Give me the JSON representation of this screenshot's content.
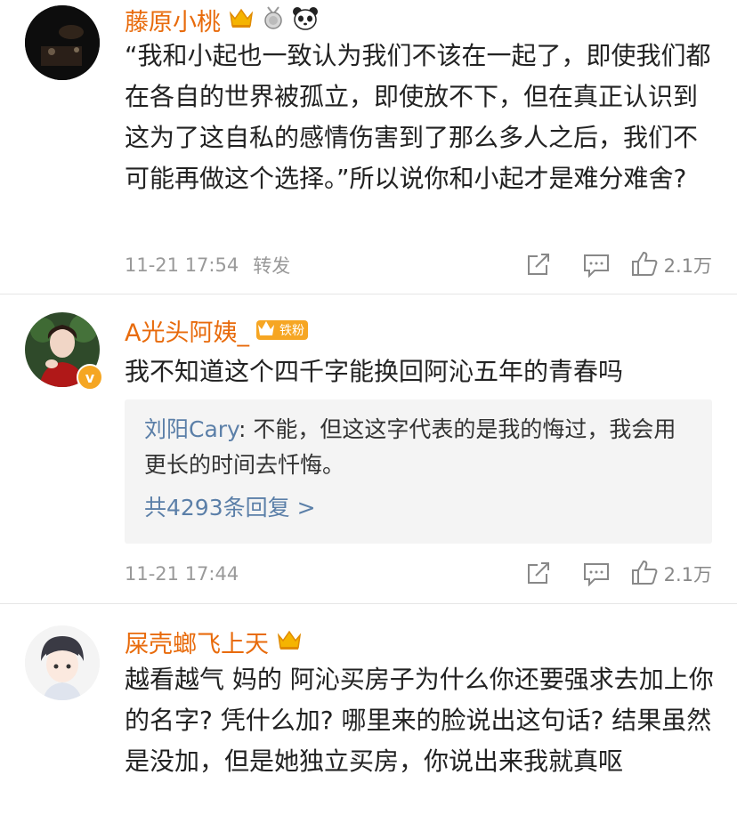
{
  "comments": [
    {
      "username": "藤原小桃",
      "text": "“我和小起也一致认为我们不该在一起了，即使我们都在各自的世界被孤立，即使放不下，但在真正认识到这为了这自私的感情伤害到了那么多人之后，我们不可能再做这个选择。”所以说你和小起才是难分难舍?",
      "timestamp": "11-21 17:54",
      "forward_label": "转发",
      "likes": "2.1万",
      "badges": [
        "crown-badge",
        "medal-badge",
        "panda-badge"
      ]
    },
    {
      "username": "A光头阿姨_",
      "badge_label": "铁粉",
      "text": "我不知道这个四千字能换回阿沁五年的青春吗",
      "reply": {
        "author": "刘阳Cary",
        "text": "不能，但这这字代表的是我的悔过，我会用更长的时间去忏悔。",
        "more_label": "共4293条回复 >"
      },
      "timestamp": "11-21 17:44",
      "likes": "2.1万",
      "verified_mark": "v"
    },
    {
      "username": "屎壳螂飞上天",
      "text": "越看越气 妈的 阿沁买房子为什么你还要强求去加上你的名字? 凭什么加? 哪里来的脸说出这句话? 结果虽然是没加，但是她独立买房，你说出来我就真呕"
    }
  ],
  "colors": {
    "username": "#e86b0c",
    "reply_author": "#5b7fa8",
    "meta": "#999999",
    "divider": "#e6e6e6"
  }
}
